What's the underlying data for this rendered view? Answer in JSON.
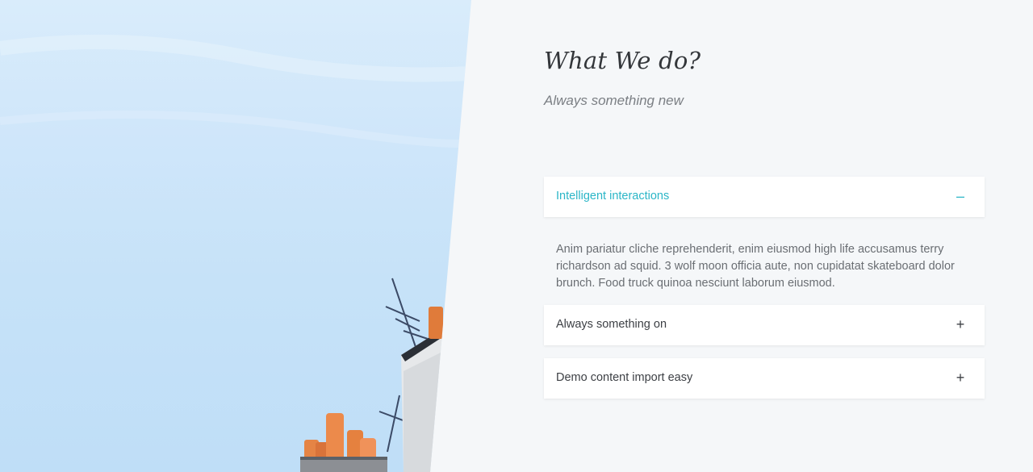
{
  "section": {
    "title": "What We do?",
    "subtitle": "Always something new"
  },
  "accordion": {
    "items": [
      {
        "label": "Intelligent interactions",
        "toggle": "–",
        "expanded": true,
        "body": "Anim pariatur cliche reprehenderit, enim eiusmod high life accusamus terry richardson ad squid. 3 wolf moon officia aute, non cupidatat skateboard dolor brunch. Food truck quinoa nesciunt laborum eiusmod."
      },
      {
        "label": "Always something on",
        "toggle": "+",
        "expanded": false
      },
      {
        "label": "Demo content import easy",
        "toggle": "+",
        "expanded": false
      }
    ]
  },
  "colors": {
    "accent": "#2bb6c7",
    "background": "#f5f7f9",
    "text": "#3d4045",
    "muted": "#7b7f84"
  }
}
